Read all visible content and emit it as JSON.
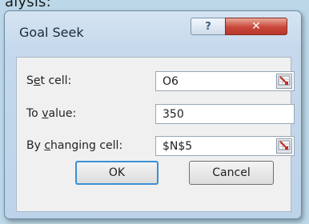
{
  "background": {
    "text": "alysis:"
  },
  "window": {
    "title": "Goal Seek",
    "help_label": "?",
    "close_label": "✕"
  },
  "fields": [
    {
      "label_pre": "S",
      "label_u": "e",
      "label_post": "t cell:",
      "value": "O6",
      "has_ref_button": true
    },
    {
      "label_pre": "To ",
      "label_u": "v",
      "label_post": "alue:",
      "value": "350",
      "has_ref_button": false
    },
    {
      "label_pre": "By ",
      "label_u": "c",
      "label_post": "hanging cell:",
      "value": "$N$5",
      "has_ref_button": true
    }
  ],
  "buttons": {
    "ok": "OK",
    "cancel": "Cancel"
  },
  "colors": {
    "titlebar": "#c6d9ec",
    "close": "#c9473a",
    "default_border": "#3d8fd4"
  }
}
